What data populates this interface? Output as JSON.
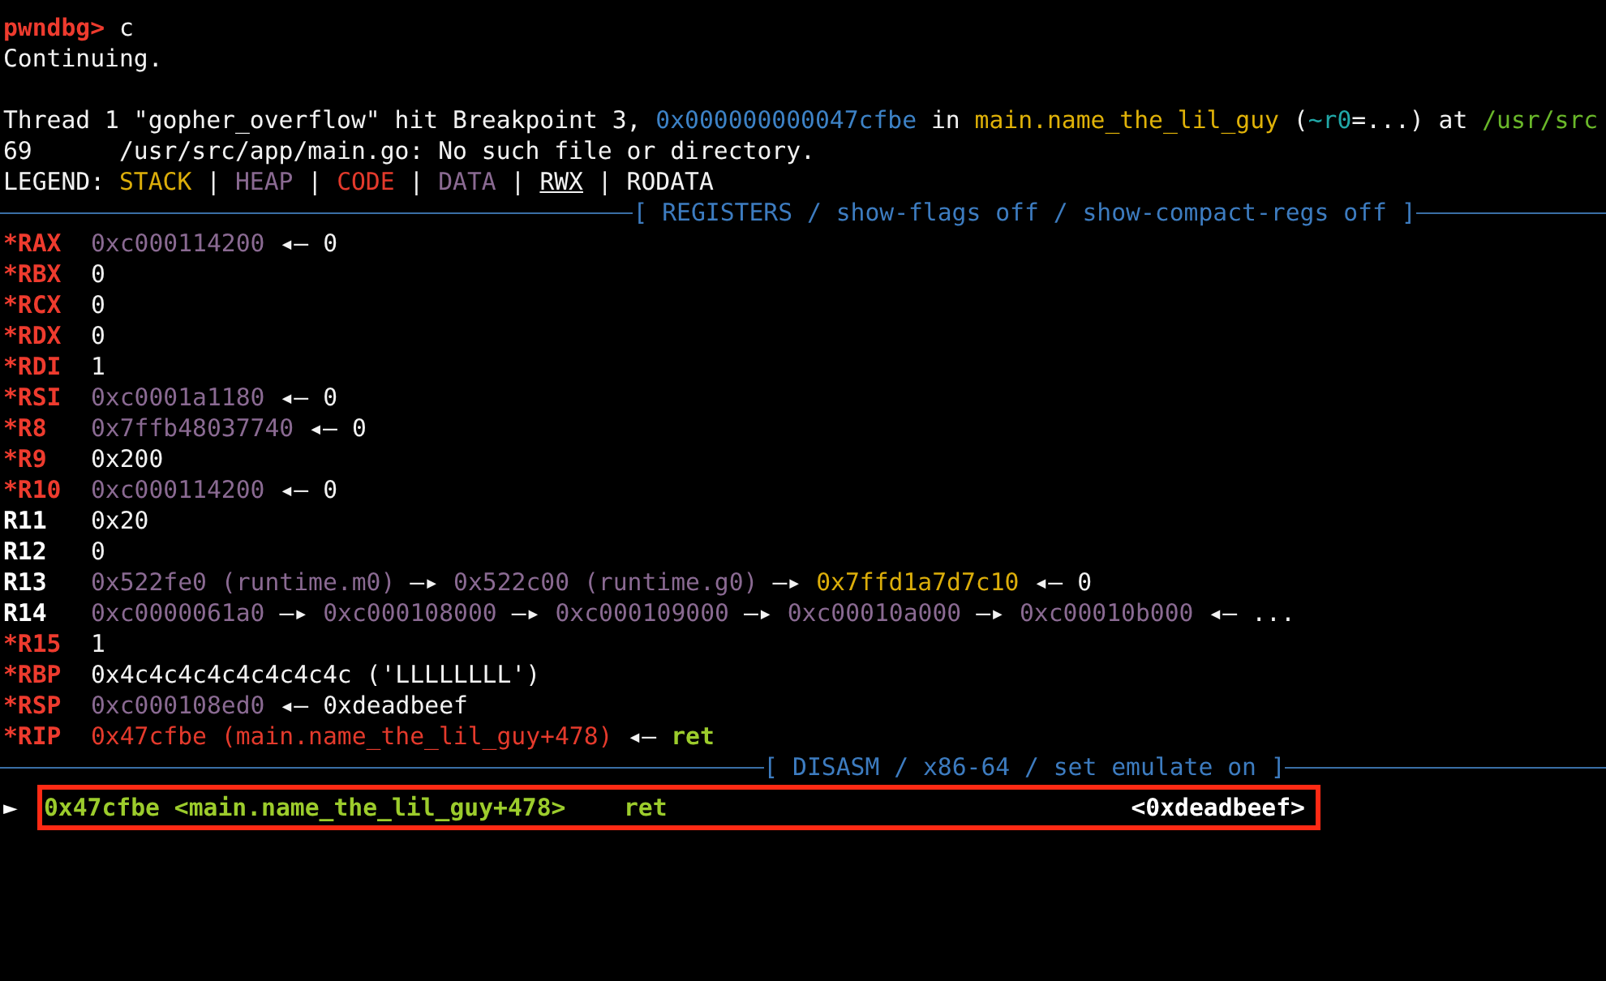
{
  "lines": [
    {
      "kind": "text",
      "segments": [
        {
          "text": "pwndbg> ",
          "kind": "prompt"
        },
        {
          "text": "c",
          "kind": "plain"
        }
      ]
    },
    {
      "kind": "text",
      "segments": [
        {
          "text": "Continuing.",
          "kind": "plain"
        }
      ]
    },
    {
      "kind": "blank"
    },
    {
      "kind": "text",
      "segments": [
        {
          "text": "Thread 1 \"gopher_overflow\" hit Breakpoint 3, ",
          "kind": "plain"
        },
        {
          "text": "0x000000000047cfbe",
          "kind": "address"
        },
        {
          "text": " in ",
          "kind": "plain"
        },
        {
          "text": "main.name_the_lil_guy",
          "kind": "symbol"
        },
        {
          "text": " (",
          "kind": "plain"
        },
        {
          "text": "~r0",
          "kind": "param"
        },
        {
          "text": "=...) at ",
          "kind": "plain"
        },
        {
          "text": "/usr/src",
          "kind": "path"
        }
      ]
    },
    {
      "kind": "text",
      "segments": [
        {
          "text": "69      /usr/src/app/main.go: No such file or directory.",
          "kind": "plain"
        }
      ]
    },
    {
      "kind": "text",
      "segments": [
        {
          "text": "LEGEND: ",
          "kind": "plain"
        },
        {
          "text": "STACK",
          "kind": "stack"
        },
        {
          "text": " | ",
          "kind": "plain"
        },
        {
          "text": "HEAP",
          "kind": "heap"
        },
        {
          "text": " | ",
          "kind": "plain"
        },
        {
          "text": "CODE",
          "kind": "code"
        },
        {
          "text": " | ",
          "kind": "plain"
        },
        {
          "text": "DATA",
          "kind": "data"
        },
        {
          "text": " | ",
          "kind": "plain"
        },
        {
          "text": "RWX",
          "kind": "rwx"
        },
        {
          "text": " | RODATA",
          "kind": "plain"
        }
      ]
    },
    {
      "kind": "separator",
      "title": "[ REGISTERS / show-flags off / show-compact-regs off ]"
    },
    {
      "kind": "register",
      "mark": "*",
      "name": "RAX",
      "changed": true,
      "chain": [
        {
          "text": "0xc000114200",
          "kind": "heap"
        },
        {
          "text": "◂—",
          "kind": "plain"
        },
        {
          "text": "0",
          "kind": "plain"
        }
      ]
    },
    {
      "kind": "register",
      "mark": "*",
      "name": "RBX",
      "changed": true,
      "chain": [
        {
          "text": "0",
          "kind": "plain"
        }
      ]
    },
    {
      "kind": "register",
      "mark": "*",
      "name": "RCX",
      "changed": true,
      "chain": [
        {
          "text": "0",
          "kind": "plain"
        }
      ]
    },
    {
      "kind": "register",
      "mark": "*",
      "name": "RDX",
      "changed": true,
      "chain": [
        {
          "text": "0",
          "kind": "plain"
        }
      ]
    },
    {
      "kind": "register",
      "mark": "*",
      "name": "RDI",
      "changed": true,
      "chain": [
        {
          "text": "1",
          "kind": "plain"
        }
      ]
    },
    {
      "kind": "register",
      "mark": "*",
      "name": "RSI",
      "changed": true,
      "chain": [
        {
          "text": "0xc0001a1180",
          "kind": "heap"
        },
        {
          "text": "◂—",
          "kind": "plain"
        },
        {
          "text": "0",
          "kind": "plain"
        }
      ]
    },
    {
      "kind": "register",
      "mark": "*",
      "name": "R8",
      "changed": true,
      "chain": [
        {
          "text": "0x7ffb48037740",
          "kind": "heap"
        },
        {
          "text": "◂—",
          "kind": "plain"
        },
        {
          "text": "0",
          "kind": "plain"
        }
      ]
    },
    {
      "kind": "register",
      "mark": "*",
      "name": "R9",
      "changed": true,
      "chain": [
        {
          "text": "0x200",
          "kind": "plain"
        }
      ]
    },
    {
      "kind": "register",
      "mark": "*",
      "name": "R10",
      "changed": true,
      "chain": [
        {
          "text": "0xc000114200",
          "kind": "heap"
        },
        {
          "text": "◂—",
          "kind": "plain"
        },
        {
          "text": "0",
          "kind": "plain"
        }
      ]
    },
    {
      "kind": "register",
      "name": "R11",
      "changed": false,
      "chain": [
        {
          "text": "0x20",
          "kind": "plain"
        }
      ]
    },
    {
      "kind": "register",
      "name": "R12",
      "changed": false,
      "chain": [
        {
          "text": "0",
          "kind": "plain"
        }
      ]
    },
    {
      "kind": "register",
      "name": "R13",
      "changed": false,
      "chain": [
        {
          "text": "0x522fe0 (runtime.m0)",
          "kind": "heap"
        },
        {
          "text": "—▸",
          "kind": "plain"
        },
        {
          "text": "0x522c00 (runtime.g0)",
          "kind": "heap"
        },
        {
          "text": "—▸",
          "kind": "plain"
        },
        {
          "text": "0x7ffd1a7d7c10",
          "kind": "stack"
        },
        {
          "text": "◂—",
          "kind": "plain"
        },
        {
          "text": "0",
          "kind": "plain"
        }
      ]
    },
    {
      "kind": "register",
      "name": "R14",
      "changed": false,
      "chain": [
        {
          "text": "0xc0000061a0",
          "kind": "heap"
        },
        {
          "text": "—▸",
          "kind": "plain"
        },
        {
          "text": "0xc000108000",
          "kind": "heap"
        },
        {
          "text": "—▸",
          "kind": "plain"
        },
        {
          "text": "0xc000109000",
          "kind": "heap"
        },
        {
          "text": "—▸",
          "kind": "plain"
        },
        {
          "text": "0xc00010a000",
          "kind": "heap"
        },
        {
          "text": "—▸",
          "kind": "plain"
        },
        {
          "text": "0xc00010b000",
          "kind": "heap"
        },
        {
          "text": "◂—",
          "kind": "plain"
        },
        {
          "text": "...",
          "kind": "plain"
        }
      ]
    },
    {
      "kind": "register",
      "mark": "*",
      "name": "R15",
      "changed": true,
      "chain": [
        {
          "text": "1",
          "kind": "plain"
        }
      ]
    },
    {
      "kind": "register",
      "mark": "*",
      "name": "RBP",
      "changed": true,
      "chain": [
        {
          "text": "0x4c4c4c4c4c4c4c4c ('LLLLLLLL')",
          "kind": "plain"
        }
      ]
    },
    {
      "kind": "register",
      "mark": "*",
      "name": "RSP",
      "changed": true,
      "chain": [
        {
          "text": "0xc000108ed0",
          "kind": "heap"
        },
        {
          "text": "◂—",
          "kind": "plain"
        },
        {
          "text": "0xdeadbeef",
          "kind": "plain"
        }
      ]
    },
    {
      "kind": "register",
      "mark": "*",
      "name": "RIP",
      "changed": true,
      "chain": [
        {
          "text": "0x47cfbe (main.name_the_lil_guy+478)",
          "kind": "code"
        },
        {
          "text": "◂—",
          "kind": "plain"
        },
        {
          "text": "ret",
          "kind": "instr"
        }
      ]
    },
    {
      "kind": "separator",
      "title": "[ DISASM / x86-64 / set emulate on ]"
    },
    {
      "kind": "disasm",
      "pointer": "►",
      "highlighted": true,
      "address": "0x47cfbe <main.name_the_lil_guy+478>",
      "instruction": "ret",
      "comment": "<0xdeadbeef>"
    }
  ]
}
